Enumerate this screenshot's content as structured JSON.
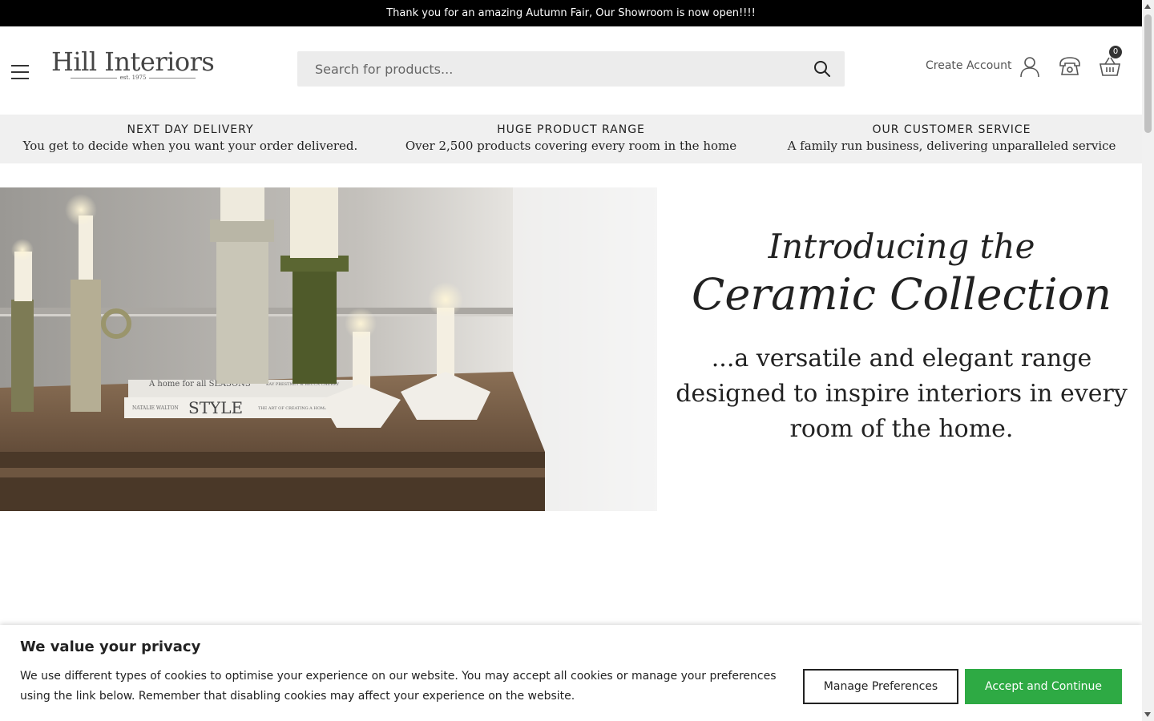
{
  "announcement": "Thank you for an amazing Autumn Fair, Our Showroom is now open!!!!",
  "header": {
    "logo_name": "Hill Interiors",
    "logo_est": "est. 1975",
    "search_placeholder": "Search for products...",
    "create_account": "Create Account",
    "cart_count": "0",
    "icons": [
      "menu-icon",
      "search-icon",
      "user-icon",
      "phone-icon",
      "basket-icon"
    ]
  },
  "usp": [
    {
      "title": "NEXT DAY DELIVERY",
      "desc": "You get to decide when you want your order delivered."
    },
    {
      "title": "HUGE PRODUCT RANGE",
      "desc": "Over 2,500 products covering every room in the home"
    },
    {
      "title": "OUR CUSTOMER SERVICE",
      "desc": "A family run business, delivering unparalleled service"
    }
  ],
  "hero": {
    "script_line1": "Introducing the",
    "script_line2": "Ceramic Collection",
    "tagline": "...a versatile and elegant range designed to inspire interiors in every room of the home.",
    "book_text_1": "A home for all SEASONS",
    "book_text_2": "STYLE",
    "book_text_3": "NATALIE WALTON",
    "book_text_4": "THE ART OF CREATING A HOME",
    "book_text_5": "KAY PRESTNEY & BECCA CHERRY"
  },
  "cookie": {
    "title": "We value your privacy",
    "body": "We use different types of cookies to optimise your experience on our website. You may accept all cookies or manage your preferences using the link below. Remember that disabling cookies may affect your experience on the website.",
    "manage_label": "Manage Preferences",
    "accept_label": "Accept and Continue"
  },
  "colors": {
    "announcement_bg": "#000000",
    "usp_bg": "#f0f0f0",
    "accept_green": "#2eaa44",
    "search_bg": "#ececec"
  }
}
